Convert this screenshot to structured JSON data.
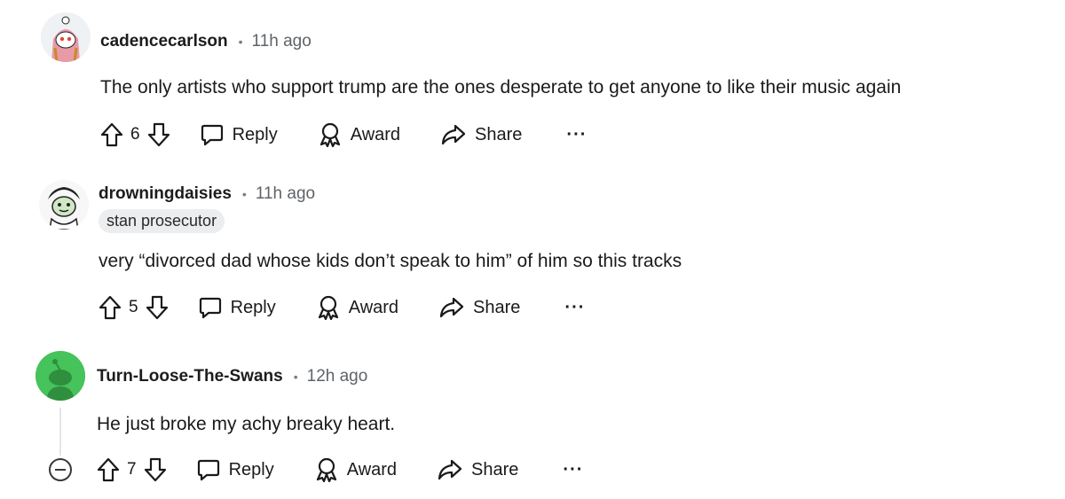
{
  "comments": [
    {
      "username": "cadencecarlson",
      "time": "11h ago",
      "flair": "",
      "text": "The only artists who support trump are the ones desperate to get anyone to like their music again",
      "votes": "6",
      "reply_label": "Reply",
      "award_label": "Award",
      "share_label": "Share",
      "more_label": "···",
      "avatar_icon": "snoo-avatar-pink-hood"
    },
    {
      "username": "drowningdaisies",
      "time": "11h ago",
      "flair": "stan prosecutor",
      "text": "very “divorced dad whose kids don’t speak to him” of him so this tracks",
      "votes": "5",
      "reply_label": "Reply",
      "award_label": "Award",
      "share_label": "Share",
      "more_label": "···",
      "avatar_icon": "snoo-avatar-green-sketch"
    },
    {
      "username": "Turn-Loose-The-Swans",
      "time": "12h ago",
      "flair": "",
      "text": "He just broke my achy breaky heart.",
      "votes": "7",
      "reply_label": "Reply",
      "award_label": "Award",
      "share_label": "Share",
      "more_label": "···",
      "avatar_icon": "snoo-avatar-green-default"
    }
  ],
  "colors": {
    "text": "#1a1a1b",
    "meta": "#5f6368",
    "flair_bg": "#ebedef",
    "avatar_green": "#46c35a"
  }
}
